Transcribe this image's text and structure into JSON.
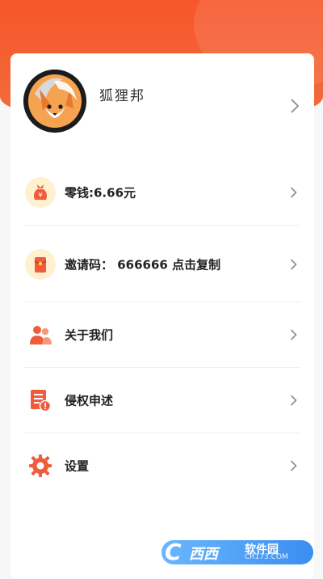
{
  "profile": {
    "name": "狐狸邦"
  },
  "menu": {
    "change_label": "零钱:6.66元",
    "invite_label": "邀请码： 666666   点击复制",
    "about_label": "关于我们",
    "complaint_label": "侵权申述",
    "settings_label": "设置"
  },
  "watermark": {
    "logo": "C",
    "name": "西西",
    "site": "软件园",
    "url": "CR173.COM"
  },
  "colors": {
    "accent": "#f6562b",
    "icon": "#ef5b3b",
    "badge_bg": "#fff0cf"
  },
  "icons": [
    "fox-avatar",
    "money-bag-icon",
    "red-envelope-icon",
    "users-icon",
    "document-alert-icon",
    "gear-icon",
    "chevron-right-icon"
  ]
}
